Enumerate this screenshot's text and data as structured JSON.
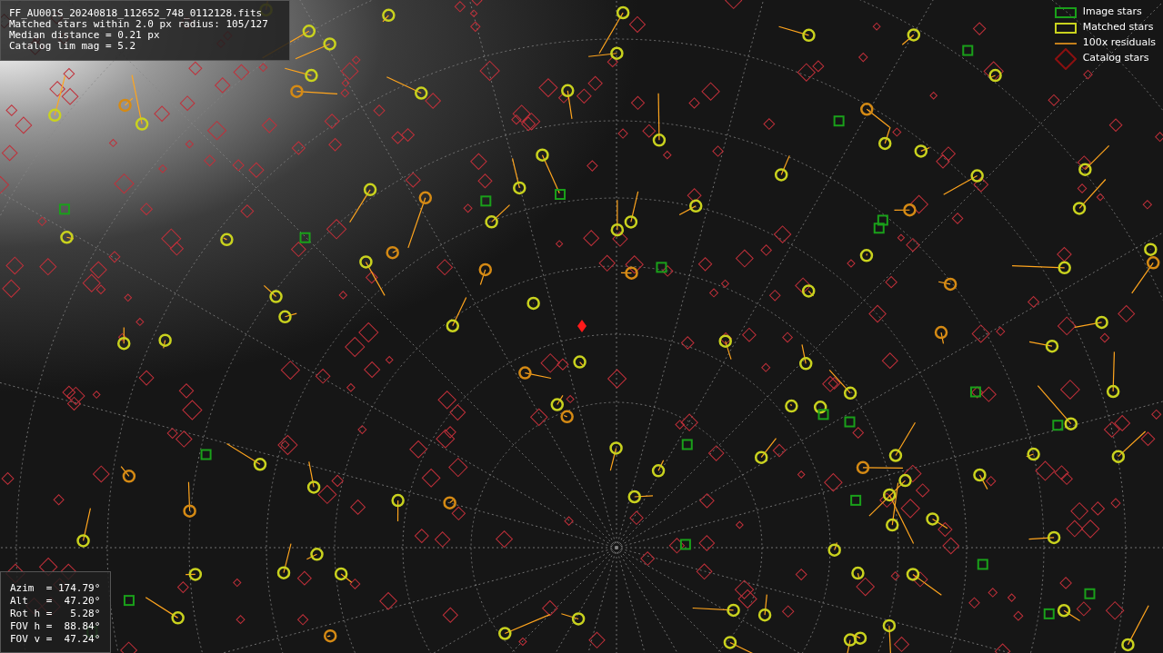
{
  "info_panel": {
    "lines": [
      "FF_AU001S_20240818_112652_748_0112128.fits",
      "Matched stars within 2.0 px radius: 105/127",
      "Median distance = 0.21 px",
      "Catalog lim mag = 5.2"
    ]
  },
  "legend": [
    {
      "kind": "image",
      "label": "Image stars"
    },
    {
      "kind": "matched",
      "label": "Matched stars"
    },
    {
      "kind": "residual",
      "label": "100x residuals"
    },
    {
      "kind": "catalog",
      "label": "Catalog stars"
    }
  ],
  "pointing_panel": {
    "lines": [
      "Azim  = 174.79°",
      "Alt   =  47.20°",
      "Rot h =   5.28°",
      "FOV h =  88.84°",
      "FOV v =  47.24°"
    ]
  }
}
